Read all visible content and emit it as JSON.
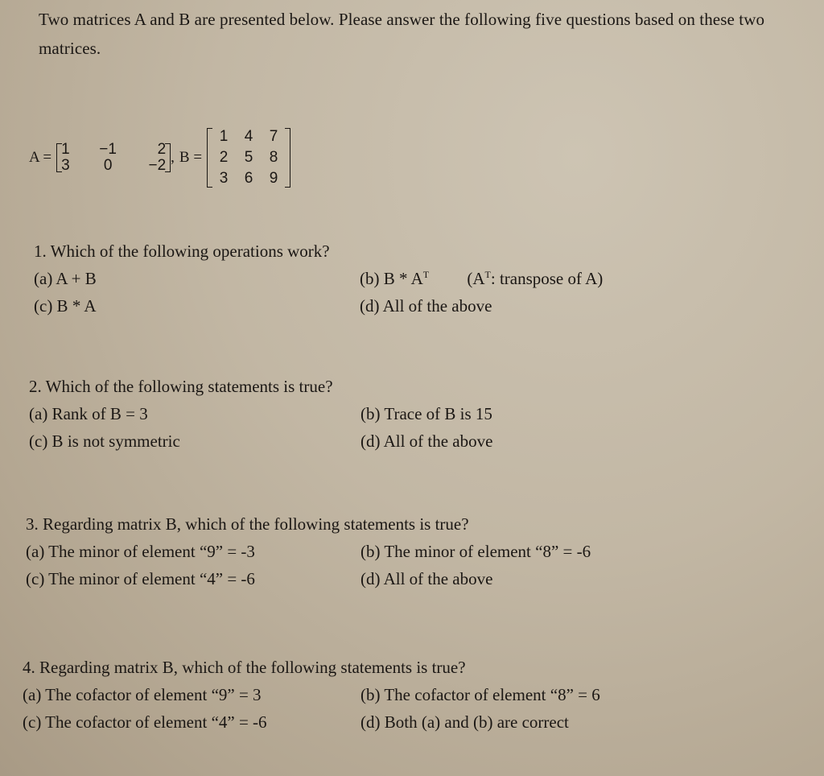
{
  "intro": "Two matrices A and B are presented below. Please answer the following five questions based on these two matrices.",
  "matrices": {
    "a_label": "A =",
    "a_rows": [
      [
        "1",
        "−1",
        "2"
      ],
      [
        "3",
        "0",
        "−2"
      ]
    ],
    "separator": ",",
    "b_label": "B =",
    "b_rows": [
      [
        "1",
        "4",
        "7"
      ],
      [
        "2",
        "5",
        "8"
      ],
      [
        "3",
        "6",
        "9"
      ]
    ]
  },
  "questions": [
    {
      "title": "1. Which of the following operations work?",
      "options": {
        "a": "(a) A + B",
        "b_main": "(b) B * A",
        "b_sup": "T",
        "b_note_pre": "(A",
        "b_note_sup": "T",
        "b_note_post": ": transpose of A)",
        "c": "(c) B * A",
        "d": "(d) All of the above"
      }
    },
    {
      "title": "2. Which of the following statements is true?",
      "options": {
        "a": "(a) Rank of B = 3",
        "b": "(b) Trace of B is 15",
        "c": "(c) B is not symmetric",
        "d": "(d) All of the above"
      }
    },
    {
      "title": "3. Regarding matrix B, which of the following statements is true?",
      "options": {
        "a": "(a) The minor of element “9” = -3",
        "b": "(b) The minor of element “8” = -6",
        "c": "(c) The minor of element “4” = -6",
        "d": "(d) All of the above"
      }
    },
    {
      "title": "4. Regarding matrix B, which of the following statements is true?",
      "options": {
        "a": "(a) The cofactor of element “9” = 3",
        "b": "(b) The cofactor of element “8” = 6",
        "c": "(c) The cofactor of element “4” = -6",
        "d": "(d) Both (a) and (b) are correct"
      }
    }
  ]
}
